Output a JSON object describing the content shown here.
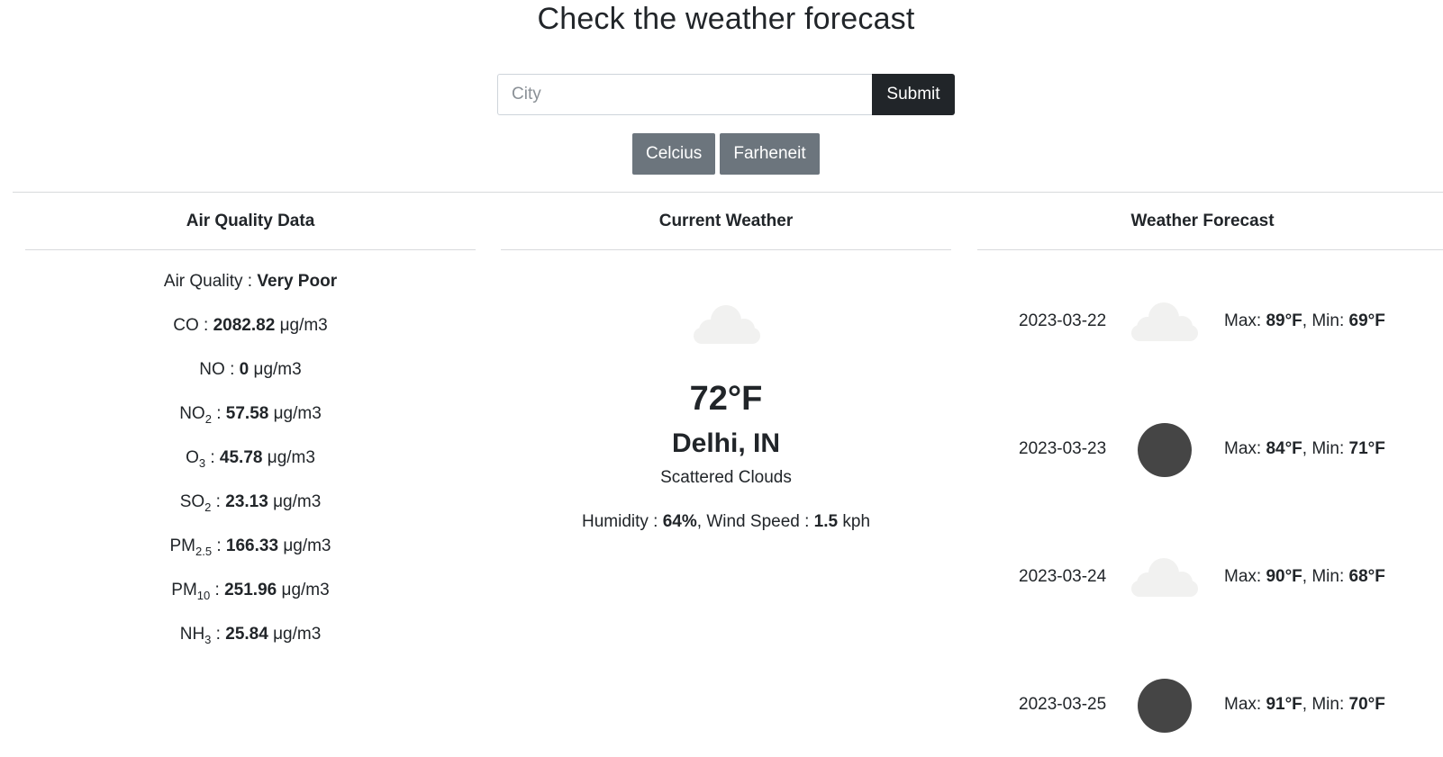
{
  "page": {
    "title": "Check the weather forecast"
  },
  "search": {
    "placeholder": "City",
    "value": "",
    "submit_label": "Submit"
  },
  "units": {
    "celsius_label": "Celcius",
    "fahrenheit_label": "Farheneit"
  },
  "air_quality": {
    "heading": "Air Quality Data",
    "items": [
      {
        "label": "Air Quality",
        "sub": "",
        "value": "Very Poor",
        "unit": ""
      },
      {
        "label": "CO",
        "sub": "",
        "value": "2082.82",
        "unit": "μg/m3"
      },
      {
        "label": "NO",
        "sub": "",
        "value": "0",
        "unit": "μg/m3"
      },
      {
        "label": "NO",
        "sub": "2",
        "value": "57.58",
        "unit": "μg/m3"
      },
      {
        "label": "O",
        "sub": "3",
        "value": "45.78",
        "unit": "μg/m3"
      },
      {
        "label": "SO",
        "sub": "2",
        "value": "23.13",
        "unit": "μg/m3"
      },
      {
        "label": "PM",
        "sub": "2.5",
        "value": "166.33",
        "unit": "μg/m3"
      },
      {
        "label": "PM",
        "sub": "10",
        "value": "251.96",
        "unit": "μg/m3"
      },
      {
        "label": "NH",
        "sub": "3",
        "value": "25.84",
        "unit": "μg/m3"
      }
    ]
  },
  "current_weather": {
    "heading": "Current Weather",
    "icon": "cloud-icon",
    "temperature": "72°F",
    "location": "Delhi, IN",
    "description": "Scattered Clouds",
    "humidity_label": "Humidity : ",
    "humidity_value": "64%",
    "wind_label": ", Wind Speed : ",
    "wind_value": "1.5",
    "wind_unit": " kph"
  },
  "forecast": {
    "heading": "Weather Forecast",
    "max_label": "Max: ",
    "min_label": ", Min: ",
    "days": [
      {
        "date": "2023-03-22",
        "icon": "cloud-icon",
        "max": "89°F",
        "min": "69°F"
      },
      {
        "date": "2023-03-23",
        "icon": "dark-circle-icon",
        "max": "84°F",
        "min": "71°F"
      },
      {
        "date": "2023-03-24",
        "icon": "cloud-icon",
        "max": "90°F",
        "min": "68°F"
      },
      {
        "date": "2023-03-25",
        "icon": "dark-circle-icon",
        "max": "91°F",
        "min": "70°F"
      }
    ]
  },
  "colors": {
    "text": "#212529",
    "submit_bg": "#212529",
    "unit_button_bg": "#6c757d",
    "rule": "#d8dadc",
    "cloud": "#f1f1f0",
    "dark_circle": "#454545"
  }
}
